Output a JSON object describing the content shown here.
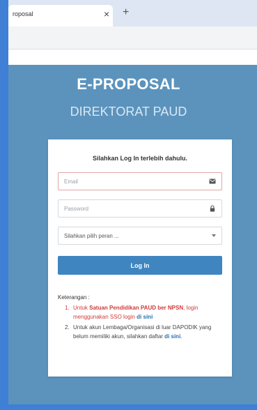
{
  "browser": {
    "tab_title": "roposal",
    "tab_close": "×",
    "new_tab": "+"
  },
  "header": {
    "title": "E-PROPOSAL",
    "subtitle": "DIREKTORAT PAUD"
  },
  "login": {
    "heading": "Silahkan Log In terlebih dahulu.",
    "email_placeholder": "Email",
    "password_placeholder": "Password",
    "role_select": "Silahkan pilih peran ...",
    "login_button": "Log In"
  },
  "notes": {
    "label": "Keterangan :",
    "item1_num": "1.",
    "item1_pre": "Untuk ",
    "item1_bold": "Satuan Pendidikan PAUD ber NPSN",
    "item1_post": ", login menggunakan SSO login ",
    "item1_link": "di sini",
    "item2_num": "2.",
    "item2_text": "Untuk akun Lembaga/Organisasi di luar DAPODIK yang belum memiliki akun, silahkan daftar ",
    "item2_link": "di sini",
    "item2_end": "."
  },
  "colors": {
    "page_background": "#5b93bd",
    "login_button": "#3f86c1",
    "warning_text": "#d03a3a",
    "link": "#2a6fb0"
  },
  "icons": {
    "email": "envelope-icon",
    "password": "lock-icon",
    "select": "caret-down-icon"
  }
}
